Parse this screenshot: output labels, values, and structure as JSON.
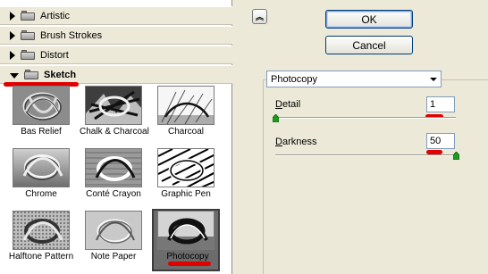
{
  "categories": [
    {
      "label": "Artistic",
      "expanded": false
    },
    {
      "label": "Brush Strokes",
      "expanded": false
    },
    {
      "label": "Distort",
      "expanded": false
    },
    {
      "label": "Sketch",
      "expanded": true
    }
  ],
  "filters": [
    {
      "label": "Bas Relief",
      "style": "relief"
    },
    {
      "label": "Chalk & Charcoal",
      "style": "chalk"
    },
    {
      "label": "Charcoal",
      "style": "charcoal"
    },
    {
      "label": "Chrome",
      "style": "chrome"
    },
    {
      "label": "Conté Crayon",
      "style": "conte"
    },
    {
      "label": "Graphic Pen",
      "style": "pen"
    },
    {
      "label": "Halftone Pattern",
      "style": "halftone"
    },
    {
      "label": "Note Paper",
      "style": "note"
    },
    {
      "label": "Photocopy",
      "style": "photocopy",
      "selected": true
    }
  ],
  "buttons": {
    "ok": "OK",
    "cancel": "Cancel",
    "collapse_glyph": "︽"
  },
  "filter_select": {
    "value": "Photocopy"
  },
  "params": {
    "detail": {
      "label_accel": "D",
      "label_rest": "etail",
      "value": "1",
      "min": 1,
      "max": 24
    },
    "darkness": {
      "label_accel": "D",
      "label_rest": "arkness",
      "value": "50",
      "min": 1,
      "max": 50
    }
  },
  "colors": {
    "annotation": "#e00000",
    "selection": "#6c6c6c"
  }
}
